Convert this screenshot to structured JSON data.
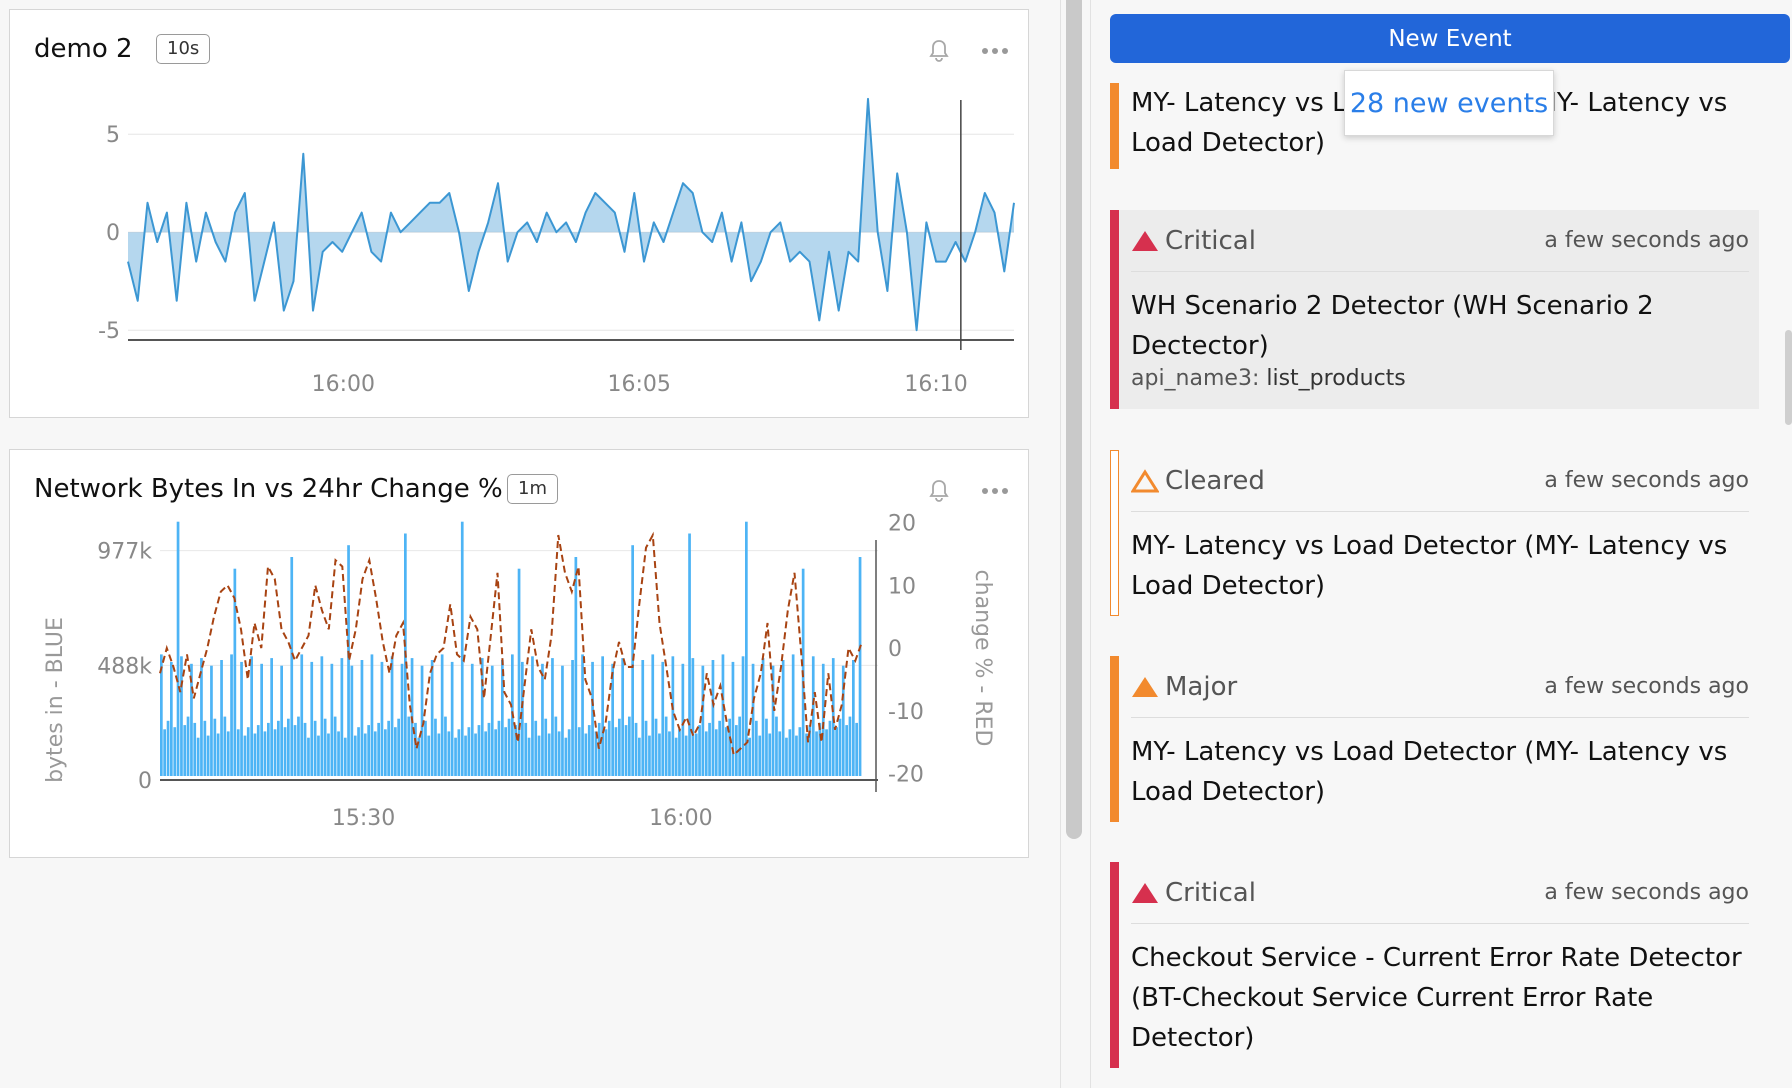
{
  "chart1": {
    "title": "demo 2",
    "resolution": "10s",
    "icons": [
      "bell-icon",
      "more-icon"
    ]
  },
  "chart2": {
    "title": "Network Bytes In vs 24hr Change %",
    "resolution": "1m",
    "icons": [
      "bell-icon",
      "more-icon"
    ]
  },
  "chart_data": [
    {
      "type": "area",
      "title": "demo 2",
      "xlabel": "",
      "ylabel": "",
      "x_ticks": [
        "16:00",
        "16:05",
        "16:10"
      ],
      "y_ticks": [
        "5",
        "0",
        "-5"
      ],
      "ylim": [
        -5.5,
        7
      ],
      "grid": true,
      "color": "#3c97d3",
      "cursor_x_fraction": 0.94,
      "series": [
        {
          "values": [
            -1.5,
            -3.5,
            1.5,
            -0.5,
            1,
            -3.5,
            1.5,
            -1.5,
            1,
            -0.5,
            -1.5,
            1,
            2,
            -3.5,
            -1.5,
            0.5,
            -4,
            -2.5,
            4,
            -4,
            -1,
            -0.5,
            -1,
            0,
            1,
            -1,
            -1.5,
            1,
            0,
            0.5,
            1,
            1.5,
            1.5,
            2,
            0,
            -3,
            -1,
            0.5,
            2.5,
            -1.5,
            0,
            0.5,
            -0.5,
            1,
            0,
            0.5,
            -0.5,
            1,
            2,
            1.5,
            1,
            -1,
            2,
            -1.5,
            0.5,
            -0.5,
            1,
            2.5,
            2,
            0,
            -0.5,
            1,
            -1.5,
            0.5,
            -2.5,
            -1.5,
            0,
            0.5,
            -1.5,
            -1,
            -1.5,
            -4.5,
            -1,
            -4,
            -1,
            -1.5,
            6.8,
            0,
            -3,
            3,
            0,
            -5,
            0.5,
            -1.5,
            -1.5,
            -0.5,
            -1.5,
            0,
            2,
            1,
            -2,
            1.5
          ]
        }
      ]
    },
    {
      "type": "bar",
      "title": "Network Bytes In vs 24hr Change %",
      "xlabel": "",
      "ylabel": "bytes in - BLUE",
      "ylabel_right": "change % - RED",
      "x_ticks": [
        "15:30",
        "16:00"
      ],
      "y_ticks_left": [
        "977k",
        "488k",
        "0"
      ],
      "y_ticks_right": [
        "20",
        "10",
        "0",
        "-10",
        "-20"
      ],
      "ylim_left": [
        0,
        1150000
      ],
      "ylim_right": [
        -21,
        22
      ],
      "bar_color": "#4db4f5",
      "line_color": "#a84312",
      "series": [
        {
          "name": "bytes in",
          "axis": "left",
          "baseline": 180000,
          "spike": 535000,
          "tall_spike": 1100000
        },
        {
          "name": "change %",
          "axis": "right",
          "values": [
            -4,
            0,
            -3,
            -7,
            -1,
            -8,
            -4,
            0,
            5,
            9,
            10,
            8,
            3,
            -5,
            4,
            0,
            13,
            11,
            3,
            1,
            -2,
            0,
            2,
            10,
            6,
            3,
            14,
            13,
            -2,
            3,
            11,
            14,
            8,
            1,
            -4,
            2,
            4,
            -9,
            -16,
            -12,
            -4,
            -1,
            0,
            7,
            -1,
            -2,
            5,
            3,
            -8,
            2,
            12,
            -7,
            -9,
            -15,
            -6,
            3,
            -3,
            -5,
            2,
            18,
            12,
            9,
            13,
            -5,
            -8,
            -16,
            -12,
            -4,
            1,
            -3,
            -3,
            7,
            16,
            18,
            4,
            -3,
            -10,
            -13,
            -11,
            -14,
            -12,
            -4,
            -9,
            -6,
            -12,
            -17,
            -16,
            -15,
            -8,
            -4,
            4,
            -10,
            -3,
            6,
            12,
            -1,
            -15,
            -7,
            -15,
            -4,
            -13,
            -9,
            0,
            -2,
            1
          ]
        }
      ]
    }
  ],
  "panel": {
    "new_event_label": "New Event",
    "tooltip": "28 new events",
    "events": [
      {
        "severity": "",
        "color": "#f28a2e",
        "time": "",
        "title": "MY- Latency vs Load Detector (MY- Latency vs Load Detector)"
      },
      {
        "severity": "Critical",
        "color": "#d6304e",
        "time": "a few seconds ago",
        "title": "WH Scenario 2 Detector (WH Scenario 2 Dectector)",
        "dim_key": "api_name3:",
        "dim_value": "list_products"
      },
      {
        "severity": "Cleared",
        "color": "#f28a2e",
        "time": "a few seconds ago",
        "title": "MY- Latency vs Load Detector (MY- Latency vs Load Detector)"
      },
      {
        "severity": "Major",
        "color": "#f28a2e",
        "time": "a few seconds ago",
        "title": "MY- Latency vs Load Detector (MY- Latency vs Load Detector)"
      },
      {
        "severity": "Critical",
        "color": "#d6304e",
        "time": "a few seconds ago",
        "title": "Checkout Service - Current Error Rate Detector (BT-Checkout Service Current Error Rate Detector)"
      }
    ]
  }
}
